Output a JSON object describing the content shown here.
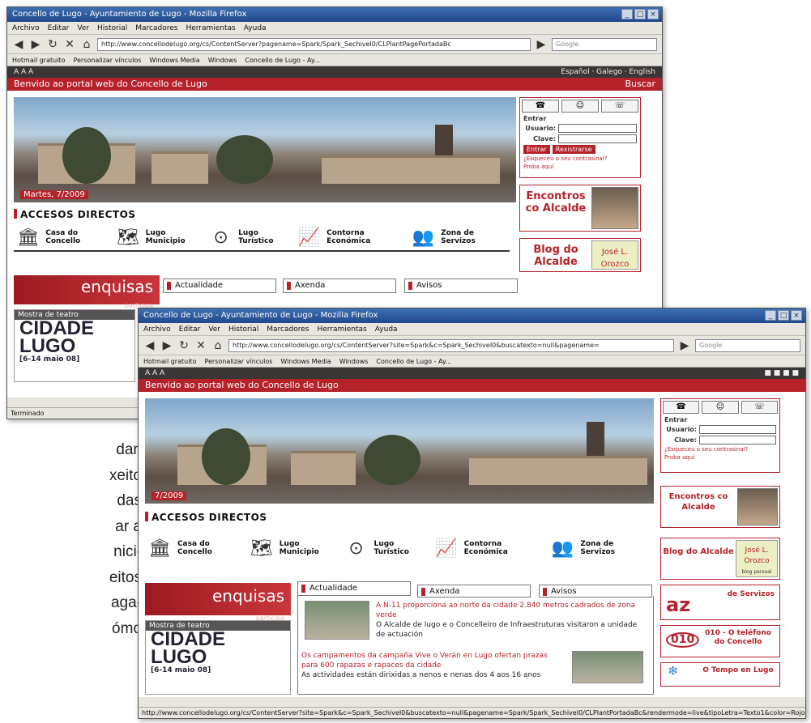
{
  "background_text": [
    "dan",
    "xeito",
    "das",
    "ar a",
    "nici-",
    "eitos",
    "aga-",
    "ómo"
  ],
  "window1": {
    "title": "Concello de Lugo - Ayuntamiento de Lugo - Mozilla Firefox",
    "menu": [
      "Archivo",
      "Editar",
      "Ver",
      "Historial",
      "Marcadores",
      "Herramientas",
      "Ayuda"
    ],
    "url": "http://www.concellodelugo.org/cs/ContentServer?pagename=Spark/Spark_SechiveI0/CLPlantPagePortadaBc",
    "search_placeholder": "Google",
    "bookmarks": [
      "Hotmail gratuito",
      "Personalizar vínculos",
      "Windows Media",
      "Windows",
      "Concello de Lugo - Ay..."
    ],
    "top_left": "A A A",
    "languages": "Español · Galego · English",
    "welcome": "Benvido ao portal web do Concello de Lugo",
    "search_label": "Buscar",
    "photo_date": "Martes, 7/2009",
    "login": {
      "tab_title": "Entrar",
      "user_label": "Usuario:",
      "pass_label": "Clave:",
      "enter": "Entrar",
      "register": "Rexistrarse",
      "forgot": "¿Esqueceu o seu contrasinal?",
      "test": "Proba aquí"
    },
    "promo1": "Encontros co Alcalde",
    "promo2": "Blog do Alcalde",
    "promo2_thumb": "José L. Orozco",
    "accesos": "ACCESOS DIRECTOS",
    "icons": [
      {
        "icon": "building-icon",
        "label": "Casa do Concello"
      },
      {
        "icon": "map-icon",
        "label": "Lugo Municipio"
      },
      {
        "icon": "compass-icon",
        "label": "Lugo Turístico"
      },
      {
        "icon": "chart-icon",
        "label": "Contorna Económica"
      },
      {
        "icon": "people-icon",
        "label": "Zona de Servizos"
      }
    ],
    "enquisas": "enquisas",
    "enquisas_sub": "participa",
    "tabs": [
      "Actualidade",
      "Axenda",
      "Avisos"
    ],
    "teatro_header": "Mostra de teatro",
    "teatro_title1": "CIDADE",
    "teatro_title2": "LUGO",
    "teatro_dates": "[6-14 maio 08]",
    "status": "Terminado"
  },
  "window2": {
    "title": "Concello de Lugo - Ayuntamiento de Lugo - Mozilla Firefox",
    "menu": [
      "Archivo",
      "Editar",
      "Ver",
      "Historial",
      "Marcadores",
      "Herramientas",
      "Ayuda"
    ],
    "url": "http://www.concellodelugo.org/cs/ContentServer?site=Spark&c=Spark_SechiveI0&buscatexto=null&pagename=",
    "search_placeholder": "Google",
    "bookmarks": [
      "Hotmail gratuito",
      "Personalizar vínculos",
      "Windows Media",
      "Windows",
      "Concello de Lugo - Ay..."
    ],
    "top_left": "A A A",
    "welcome": "Benvido ao portal web do Concello de Lugo",
    "photo_date": "7/2009",
    "login": {
      "tab_title": "Entrar",
      "user_label": "Usuario:",
      "pass_label": "Clave:",
      "forgot": "¿Esqueceu o seu contrasinal?",
      "test": "Proba aquí"
    },
    "promo1": "Encontros co Alcalde",
    "promo2": "Blog do Alcalde",
    "promo2_thumb": "José L. Orozco",
    "promo2_sub": "blog persoal",
    "accesos": "ACCESOS DIRECTOS",
    "icons": [
      {
        "icon": "building-icon",
        "label": "Casa do Concello"
      },
      {
        "icon": "map-icon",
        "label": "Lugo Municipio"
      },
      {
        "icon": "compass-icon",
        "label": "Lugo Turístico"
      },
      {
        "icon": "chart-icon",
        "label": "Contorna Económica"
      },
      {
        "icon": "people-icon",
        "label": "Zona de Servizos"
      }
    ],
    "enquisas": "enquisas",
    "enquisas_sub": "participa",
    "tabs": [
      "Actualidade",
      "Axenda",
      "Avisos"
    ],
    "news": [
      {
        "title": "A N-11 proporciona ao norte da cidade 2.840 metros cadrados de zona verde",
        "body": "O Alcalde de lugo e o Concelleiro de Infraestruturas visitaron a unidade de actuación"
      },
      {
        "title": "Os campamentos da campaña Vive o Verán en Lugo ofertan prazas para 600 rapazas e rapaces da cidade",
        "body": "As actividades están dirixidas a nenos e nenas dos 4 aos 16 anos"
      }
    ],
    "teatro_header": "Mostra de teatro",
    "teatro_title1": "CIDADE",
    "teatro_title2": "LUGO",
    "teatro_dates": "[6-14 maio 08]",
    "az_label": "de Servizos",
    "phone_label": "010 - O teléfono do Concello",
    "weather_label": "O Tempo en Lugo",
    "status": "http://www.concellodelugo.org/cs/ContentServer?site=Spark&c=Spark_SechiveI0&buscatexto=null&pagename=Spark/Spark_SechiveI0/CLPlantPortadaBc&rendermode=live&tipoLetra=Texto1&color=Rojo"
  }
}
